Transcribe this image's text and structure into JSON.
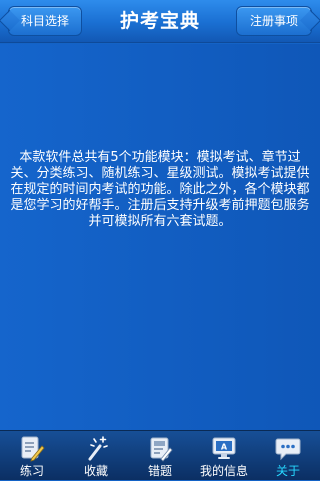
{
  "header": {
    "left_button": "科目选择",
    "title": "护考宝典",
    "right_button": "注册事项"
  },
  "main": {
    "description": "本款软件总共有5个功能模块：模拟考试、章节过关、分类练习、随机练习、星级测试。模拟考试提供在规定的时间内考试的功能。除此之外，各个模块都是您学习的好帮手。注册后支持升级考前押题包服务并可模拟所有六套试题。"
  },
  "tabs": [
    {
      "label": "练习",
      "icon": "pencil-paper-icon",
      "active": false
    },
    {
      "label": "收藏",
      "icon": "magic-wand-icon",
      "active": false
    },
    {
      "label": "错题",
      "icon": "error-edit-icon",
      "active": false
    },
    {
      "label": "我的信息",
      "icon": "monitor-icon",
      "active": false
    },
    {
      "label": "关于",
      "icon": "chat-bubble-icon",
      "active": true
    }
  ],
  "colors": {
    "background": "#1463c6",
    "tabbar": "#0b2f63",
    "active_tab_label": "#27d8ff"
  }
}
